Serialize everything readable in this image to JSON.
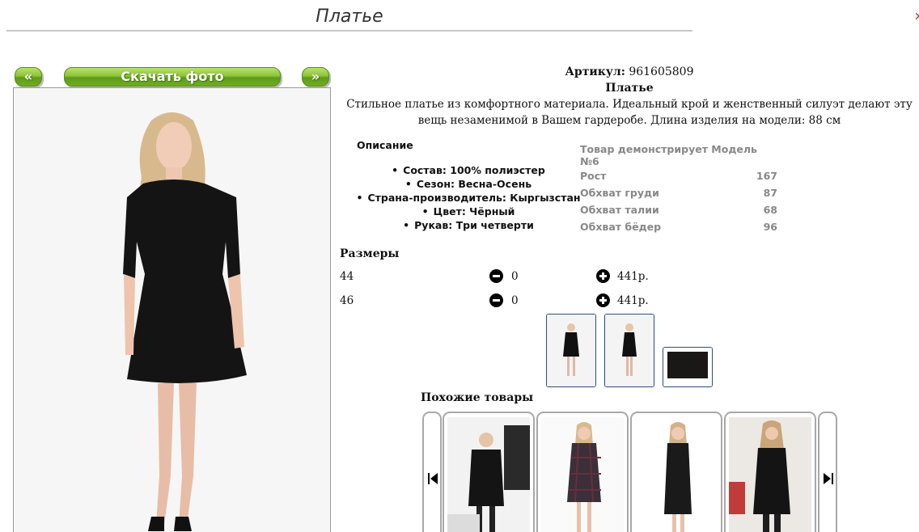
{
  "page": {
    "title": "Платье"
  },
  "photo_nav": {
    "prev_label": "«",
    "download_label": "Скачать фото",
    "next_label": "»"
  },
  "product": {
    "article_label": "Артикул:",
    "article_value": "961605809",
    "name": "Платье",
    "description": "Стильное платье из комфортного материала. Идеальный крой и женственный силуэт делают эту вещь незаменимой в Вашем гардеробе. Длина изделия на модели: 88 см"
  },
  "description_block": {
    "title": "Описание",
    "properties": [
      "Состав: 100% полиэстер",
      "Сезон: Весна-Осень",
      "Страна-производитель: Кыргызстан",
      "Цвет: Чёрный",
      "Рукав: Три четверти"
    ]
  },
  "model": {
    "heading": "Товар демонстрирует Модель №6",
    "params": [
      {
        "label": "Рост",
        "value": "167"
      },
      {
        "label": "Обхват груди",
        "value": "87"
      },
      {
        "label": "Обхват талии",
        "value": "68"
      },
      {
        "label": "Обхват бёдер",
        "value": "96"
      }
    ]
  },
  "sizes": {
    "title": "Размеры",
    "rows": [
      {
        "size": "44",
        "qty": "0",
        "price": "441р."
      },
      {
        "size": "46",
        "qty": "0",
        "price": "441р."
      }
    ]
  },
  "similar": {
    "title": "Похожие товары"
  },
  "colors": {
    "button_green": "#6fae20",
    "thumb_border": "#2a4f7a",
    "model_text": "#888888"
  }
}
